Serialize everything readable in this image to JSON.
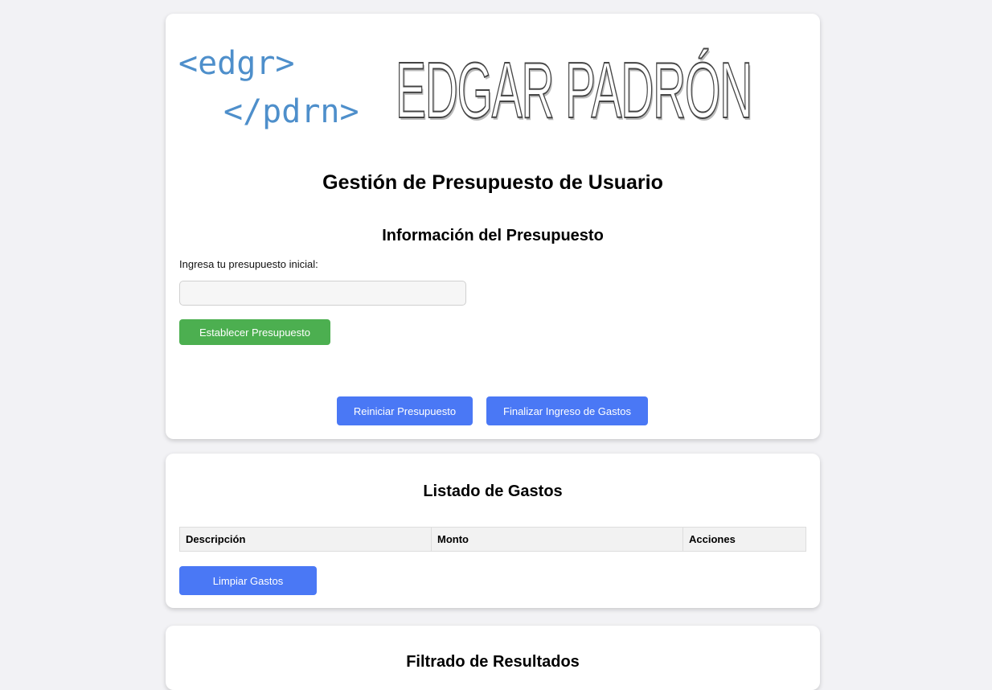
{
  "logo": {
    "code_line1": "<edgr>",
    "code_line2": "</pdrn>",
    "name": "EDGAR PADRÓN"
  },
  "page_title": "Gestión de Presupuesto de Usuario",
  "budget": {
    "heading": "Información del Presupuesto",
    "input_label": "Ingresa tu presupuesto inicial:",
    "input_value": "",
    "input_placeholder": "",
    "set_button": "Establecer Presupuesto",
    "reset_button": "Reiniciar Presupuesto",
    "finish_button": "Finalizar Ingreso de Gastos"
  },
  "expenses": {
    "heading": "Listado de Gastos",
    "columns": [
      "Descripción",
      "Monto",
      "Acciones"
    ],
    "rows": [],
    "clear_button": "Limpiar Gastos"
  },
  "filter": {
    "heading": "Filtrado de Resultados"
  },
  "colors": {
    "green_button": "#4caf50",
    "blue_button": "#4a78f5",
    "logo_code": "#4e8fcb",
    "background": "#f2f2f5"
  }
}
